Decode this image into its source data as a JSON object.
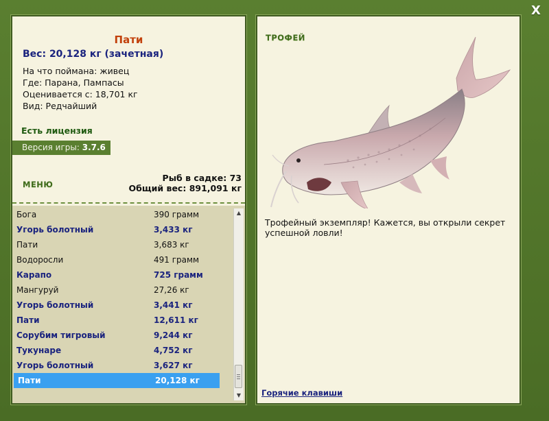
{
  "window": {
    "close_label": "X"
  },
  "fish_info": {
    "name": "Пати",
    "weight_line": "Вес: 20,128 кг (зачетная)",
    "bait_line": "На что поймана: живец",
    "place_line": "Где: Парана, Пампасы",
    "estimate_line": "Оценивается с: 18,701 кг",
    "kind_line": "Вид: Редчайший"
  },
  "license_text": "Есть лицензия",
  "version": {
    "label": "Версия игры:",
    "value": "3.7.6"
  },
  "menu_label": "МЕНЮ",
  "cage": {
    "count_line": "Рыб в садке: 73",
    "total_line": "Общий вес: 891,091 кг"
  },
  "catch_list": [
    {
      "name": "Бога",
      "weight": "390 грамм",
      "trophy": false,
      "selected": false
    },
    {
      "name": "Угорь болотный",
      "weight": "3,433 кг",
      "trophy": true,
      "selected": false
    },
    {
      "name": "Пати",
      "weight": "3,683 кг",
      "trophy": false,
      "selected": false
    },
    {
      "name": "Водоросли",
      "weight": "491 грамм",
      "trophy": false,
      "selected": false
    },
    {
      "name": "Карапо",
      "weight": "725 грамм",
      "trophy": true,
      "selected": false
    },
    {
      "name": "Мангуруй",
      "weight": "27,26 кг",
      "trophy": false,
      "selected": false
    },
    {
      "name": "Угорь болотный",
      "weight": "3,441 кг",
      "trophy": true,
      "selected": false
    },
    {
      "name": "Пати",
      "weight": "12,611 кг",
      "trophy": true,
      "selected": false
    },
    {
      "name": "Сорубим тигровый",
      "weight": "9,244 кг",
      "trophy": true,
      "selected": false
    },
    {
      "name": "Тукунаре",
      "weight": "4,752 кг",
      "trophy": true,
      "selected": false
    },
    {
      "name": "Угорь болотный",
      "weight": "3,627 кг",
      "trophy": true,
      "selected": false
    },
    {
      "name": "Пати",
      "weight": "20,128 кг",
      "trophy": true,
      "selected": true
    }
  ],
  "trophy_panel": {
    "title": "ТРОФЕЙ",
    "message": "Трофейный экземпляр! Кажется, вы открыли секрет успешной ловли!",
    "hotkeys_link": "Горячие клавиши"
  },
  "colors": {
    "frame_green": "#4f7429",
    "panel_cream": "#f6f3e0",
    "list_bg": "#d9d5b4",
    "selected_row": "#3aa0f0",
    "trophy_text": "#1a237e",
    "fish_name": "#c2410c"
  },
  "icons": {
    "close": "close-icon",
    "scroll_up": "arrow-up-icon",
    "scroll_down": "arrow-down-icon"
  }
}
